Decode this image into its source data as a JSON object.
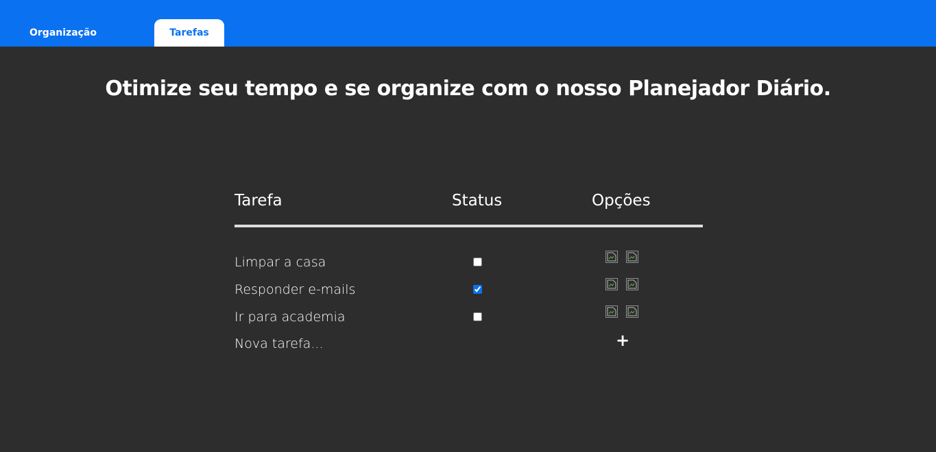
{
  "nav": {
    "tabs": [
      {
        "label": "Organização",
        "active": false
      },
      {
        "label": "Tarefas",
        "active": true
      }
    ]
  },
  "hero": {
    "headline": "Otimize seu tempo e se organize com o nosso Planejador Diário."
  },
  "table": {
    "headers": {
      "task": "Tarefa",
      "status": "Status",
      "options": "Opções"
    },
    "rows": [
      {
        "task": "Limpar a casa",
        "done": false,
        "option_icons": [
          "broken-image-icon",
          "broken-image-icon"
        ]
      },
      {
        "task": "Responder e-mails",
        "done": true,
        "option_icons": [
          "broken-image-icon",
          "broken-image-icon"
        ]
      },
      {
        "task": "Ir para academia",
        "done": false,
        "option_icons": [
          "broken-image-icon",
          "broken-image-icon"
        ]
      }
    ],
    "new_task": {
      "placeholder": "Nova tarefa...",
      "add_label": "+"
    }
  },
  "colors": {
    "nav_blue": "#0a71f0",
    "background": "#2d2d2d",
    "text": "#ffffff",
    "checkbox_accent": "#0a71f0"
  }
}
